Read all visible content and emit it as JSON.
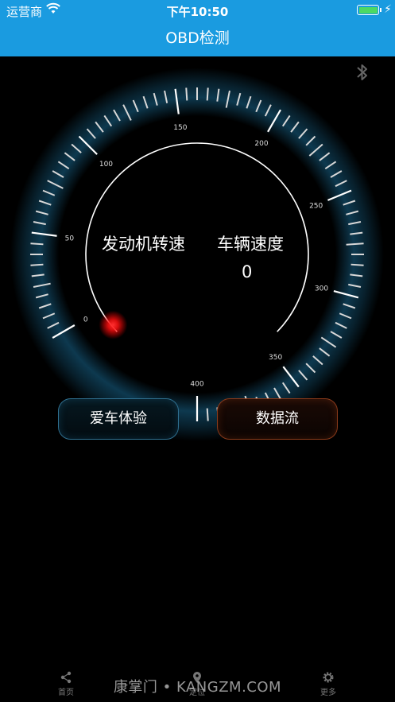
{
  "status_bar": {
    "carrier": "运营商",
    "time": "下午10:50"
  },
  "nav": {
    "title": "OBD检测"
  },
  "gauge": {
    "tick_labels": [
      "0",
      "50",
      "100",
      "150",
      "200",
      "250",
      "300",
      "350",
      "400"
    ],
    "engine_rpm_label": "发动机转速",
    "vehicle_speed_label": "车辆速度",
    "vehicle_speed_value": "0"
  },
  "buttons": {
    "left_label": "爱车体验",
    "right_label": "数据流"
  },
  "tabs": [
    {
      "label": "首页",
      "icon": "share-icon"
    },
    {
      "label": "定位",
      "icon": "location-icon"
    },
    {
      "label": "更多",
      "icon": "gear-icon"
    }
  ],
  "watermark": "康掌门 • KANGZM.COM",
  "colors": {
    "nav_blue": "#1a9be0",
    "glow_blue": "#1e7fb0",
    "needle_red": "#ff2020"
  }
}
